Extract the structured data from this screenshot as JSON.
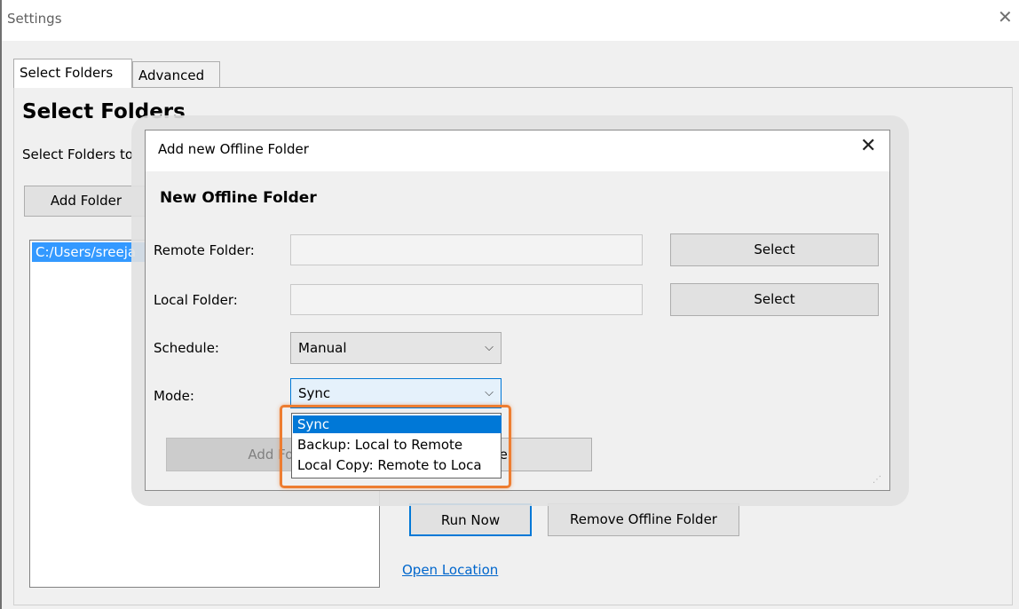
{
  "window": {
    "title": "Settings",
    "close_glyph": "✕"
  },
  "tabs": [
    {
      "label": "Select Folders"
    },
    {
      "label": "Advanced"
    }
  ],
  "main": {
    "heading": "Select Folders",
    "description": "Select Folders to",
    "add_folder_label": "Add Folder",
    "folder_list": [
      "C:/Users/sreeja"
    ],
    "run_now_label": "Run Now",
    "remove_label": "Remove Offline Folder",
    "open_location_label": "Open Location"
  },
  "dialog": {
    "title": "Add new Offline Folder",
    "close_glyph": "✕",
    "heading": "New Offline Folder",
    "remote_label": "Remote Folder:",
    "remote_value": "",
    "local_label": "Local Folder:",
    "local_value": "",
    "select_label": "Select",
    "schedule_label": "Schedule:",
    "schedule_value": "Manual",
    "mode_label": "Mode:",
    "mode_value": "Sync",
    "add_button_label": "Add Fol",
    "cancel_button_label": "el",
    "mode_options": [
      "Sync",
      "Backup: Local to Remote",
      "Local Copy: Remote to Loca"
    ]
  },
  "icons": {
    "chevron": "chevron-down-icon",
    "close": "close-icon",
    "grip": "resize-grip-icon"
  },
  "colors": {
    "selection": "#0078d7",
    "highlight_box": "#ed7d31",
    "link": "#0066cc"
  }
}
